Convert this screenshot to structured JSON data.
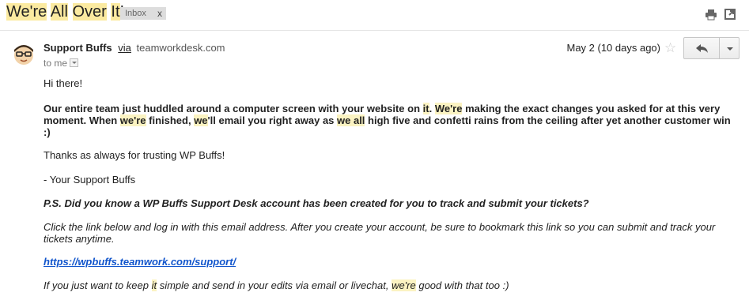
{
  "header": {
    "subject_parts": [
      "We're",
      " ",
      "All",
      " ",
      "Over",
      " ",
      "It",
      "!"
    ],
    "label": "Inbox",
    "label_close": "x",
    "icons": [
      "print-icon",
      "new-window-icon"
    ]
  },
  "message": {
    "sender_name": "Support Buffs",
    "via": "via",
    "domain": "teamworkdesk.com",
    "to": "to me",
    "date": "May 2 (10 days ago)",
    "star": "☆",
    "avatar": "support-avatar-icon",
    "reply_icon": "reply-icon",
    "more_icon": "chevron-down-icon"
  },
  "body": {
    "greeting": "Hi there!",
    "para1": [
      {
        "t": "Our entire team just huddled around a computer screen with your website on ",
        "h": false
      },
      {
        "t": "it",
        "h": true
      },
      {
        "t": ". ",
        "h": false
      },
      {
        "t": "We're",
        "h": true
      },
      {
        "t": " making the exact changes you asked for at this very moment. When ",
        "h": false
      },
      {
        "t": "we're",
        "h": true
      },
      {
        "t": " finished, ",
        "h": false
      },
      {
        "t": "we",
        "h": true
      },
      {
        "t": "'ll email you right away as ",
        "h": false
      },
      {
        "t": "we all",
        "h": true
      },
      {
        "t": " high five and confetti rains from the ceiling after yet another customer win :)",
        "h": false
      }
    ],
    "thanks": "Thanks as always for trusting WP Buffs!",
    "signature": "- Your Support Buffs",
    "ps": "P.S. Did you know a WP Buffs Support Desk account has been created for you to track and submit your tickets?",
    "instructions": "Click the link below and log in with this email address. After you create your account, be sure to bookmark this link so you can submit and track your tickets anytime.",
    "link": "https://wpbuffs.teamwork.com/support/",
    "closing": [
      {
        "t": "If you just want to keep ",
        "h": false
      },
      {
        "t": "it",
        "h": true
      },
      {
        "t": " simple and send in your edits via email or livechat, ",
        "h": false
      },
      {
        "t": "we're",
        "h": true
      },
      {
        "t": " good with that too :)",
        "h": false
      }
    ]
  },
  "colors": {
    "highlight": "#fbf3c2",
    "link": "#1155cc",
    "label_bg": "#dddddd"
  }
}
